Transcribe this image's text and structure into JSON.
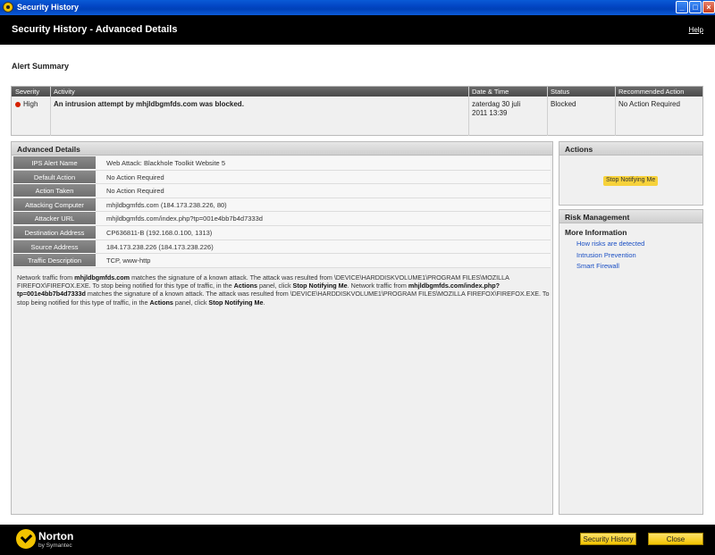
{
  "window": {
    "title": "Security History",
    "controls": [
      "minimize",
      "maximize",
      "close"
    ]
  },
  "header": {
    "title": "Security History - Advanced Details",
    "help_label": "Help"
  },
  "alert_summary": {
    "title": "Alert Summary",
    "columns": [
      "Severity",
      "Activity",
      "Date & Time",
      "Status",
      "Recommended Action"
    ],
    "row": {
      "severity": "High",
      "severity_color": "#d62000",
      "activity": "An intrusion attempt by mhjldbgmfds.com was blocked.",
      "date_line1": "zaterdag 30 juli",
      "date_line2": "2011 13:39",
      "status": "Blocked",
      "recommended_action": "No Action Required"
    }
  },
  "advanced_details": {
    "title": "Advanced Details",
    "rows": [
      {
        "label": "IPS Alert Name",
        "value": "Web Attack: Blackhole Toolkit Website 5"
      },
      {
        "label": "Default Action",
        "value": "No Action Required"
      },
      {
        "label": "Action Taken",
        "value": "No Action Required"
      },
      {
        "label": "Attacking Computer",
        "value": "mhjldbgmfds.com (184.173.238.226, 80)"
      },
      {
        "label": "Attacker URL",
        "value": "mhjldbgmfds.com/index.php?tp=001e4bb7b4d7333d"
      },
      {
        "label": "Destination Address",
        "value": "CP636811-B (192.168.0.100, 1313)"
      },
      {
        "label": "Source Address",
        "value": "184.173.238.226 (184.173.238.226)"
      },
      {
        "label": "Traffic Description",
        "value": "TCP, www-http"
      }
    ],
    "description": {
      "p1": "Network traffic from ",
      "b1": "mhjldbgmfds.com",
      "p2": " matches the signature of a known attack. The attack was resulted from \\DEVICE\\HARDDISKVOLUME1\\PROGRAM FILES\\MOZILLA FIREFOX\\FIREFOX.EXE. To stop being notified for this type of traffic, in the ",
      "b2": "Actions",
      "p3": " panel, click ",
      "b3": "Stop Notifying Me",
      "p4": ". Network traffic from ",
      "b4": "mhjldbgmfds.com/index.php?tp=001e4bb7b4d7333d",
      "p5": " matches the signature of a known attack. The attack was resulted from \\DEVICE\\HARDDISKVOLUME1\\PROGRAM FILES\\MOZILLA FIREFOX\\FIREFOX.EXE. To stop being notified for this type of traffic, in the ",
      "b5": "Actions",
      "p6": " panel, click ",
      "b6": "Stop Notifying Me",
      "p7": "."
    }
  },
  "actions_panel": {
    "title": "Actions",
    "stop_label": "Stop Notifying Me"
  },
  "risk_panel": {
    "title": "Risk Management",
    "more_info": "More Information",
    "links": [
      "How risks are detected",
      "Intrusion Prevention",
      "Smart Firewall"
    ]
  },
  "footer": {
    "brand": "Norton",
    "brand_sub": "by Symantec",
    "history_label": "Security History",
    "close_label": "Close"
  },
  "colors": {
    "accent": "#f2c300",
    "header_bg": "#000000",
    "link": "#1a4fc4"
  }
}
